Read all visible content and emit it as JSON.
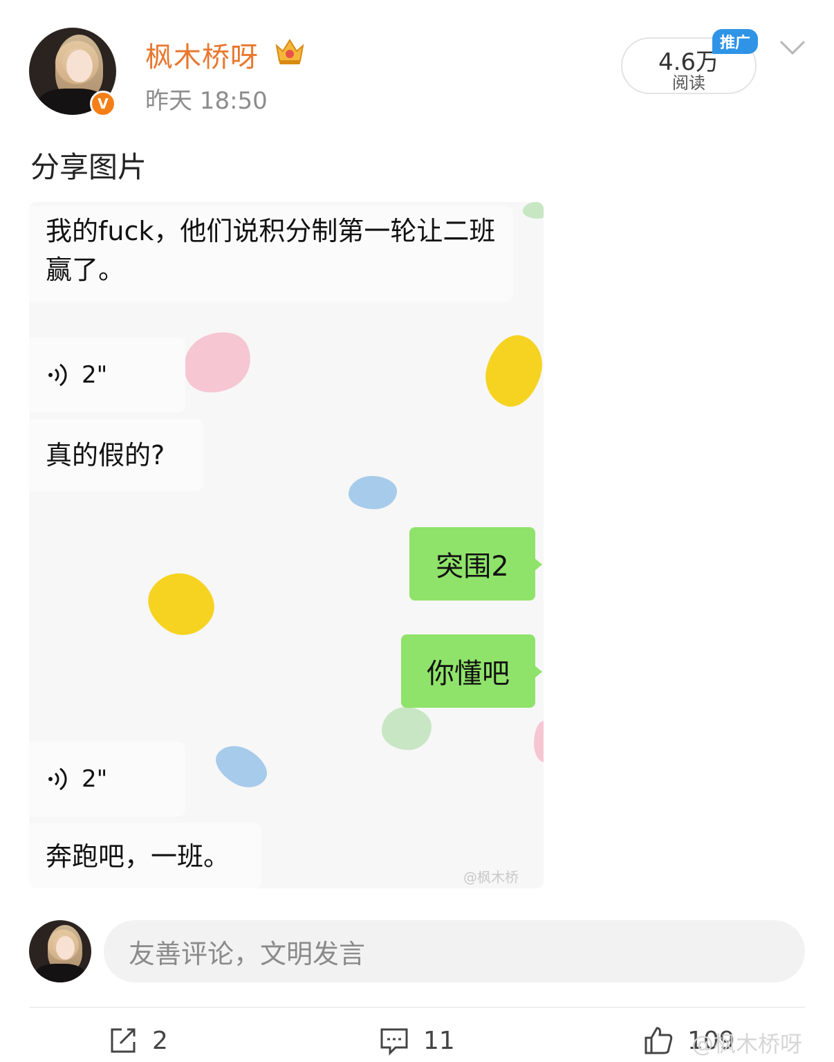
{
  "author": {
    "name": "枫木桥呀",
    "verified_badge": "V",
    "time": "昨天 18:50",
    "avatar_icon": "user-avatar",
    "crown_icon": "vip-crown-icon"
  },
  "reads": {
    "count": "4.6万",
    "label": "阅读",
    "promo_badge": "推广"
  },
  "post": {
    "text": "分享图片"
  },
  "chat_image": {
    "messages": [
      {
        "type": "text",
        "side": "left",
        "text": "我的fuck，他们说积分制第一轮让二班赢了。"
      },
      {
        "type": "voice",
        "side": "left",
        "duration": "2\""
      },
      {
        "type": "text",
        "side": "left",
        "text": "真的假的?"
      },
      {
        "type": "text",
        "side": "right",
        "text": "突围2"
      },
      {
        "type": "text",
        "side": "right",
        "text": "你懂吧"
      },
      {
        "type": "voice",
        "side": "left",
        "duration": "2\""
      },
      {
        "type": "text",
        "side": "left",
        "text": "奔跑吧，一班。"
      }
    ],
    "watermark": "@枫木桥"
  },
  "comment_box": {
    "placeholder": "友善评论，文明发言"
  },
  "actions": {
    "repost_count": "2",
    "comment_count": "11",
    "like_count": "109"
  },
  "watermark": "@枫木桥呀",
  "colors": {
    "author_name": "#e8772e",
    "verified": "#f57f17",
    "promo": "#2f94e6",
    "outgoing_bubble": "#8fe36a"
  }
}
